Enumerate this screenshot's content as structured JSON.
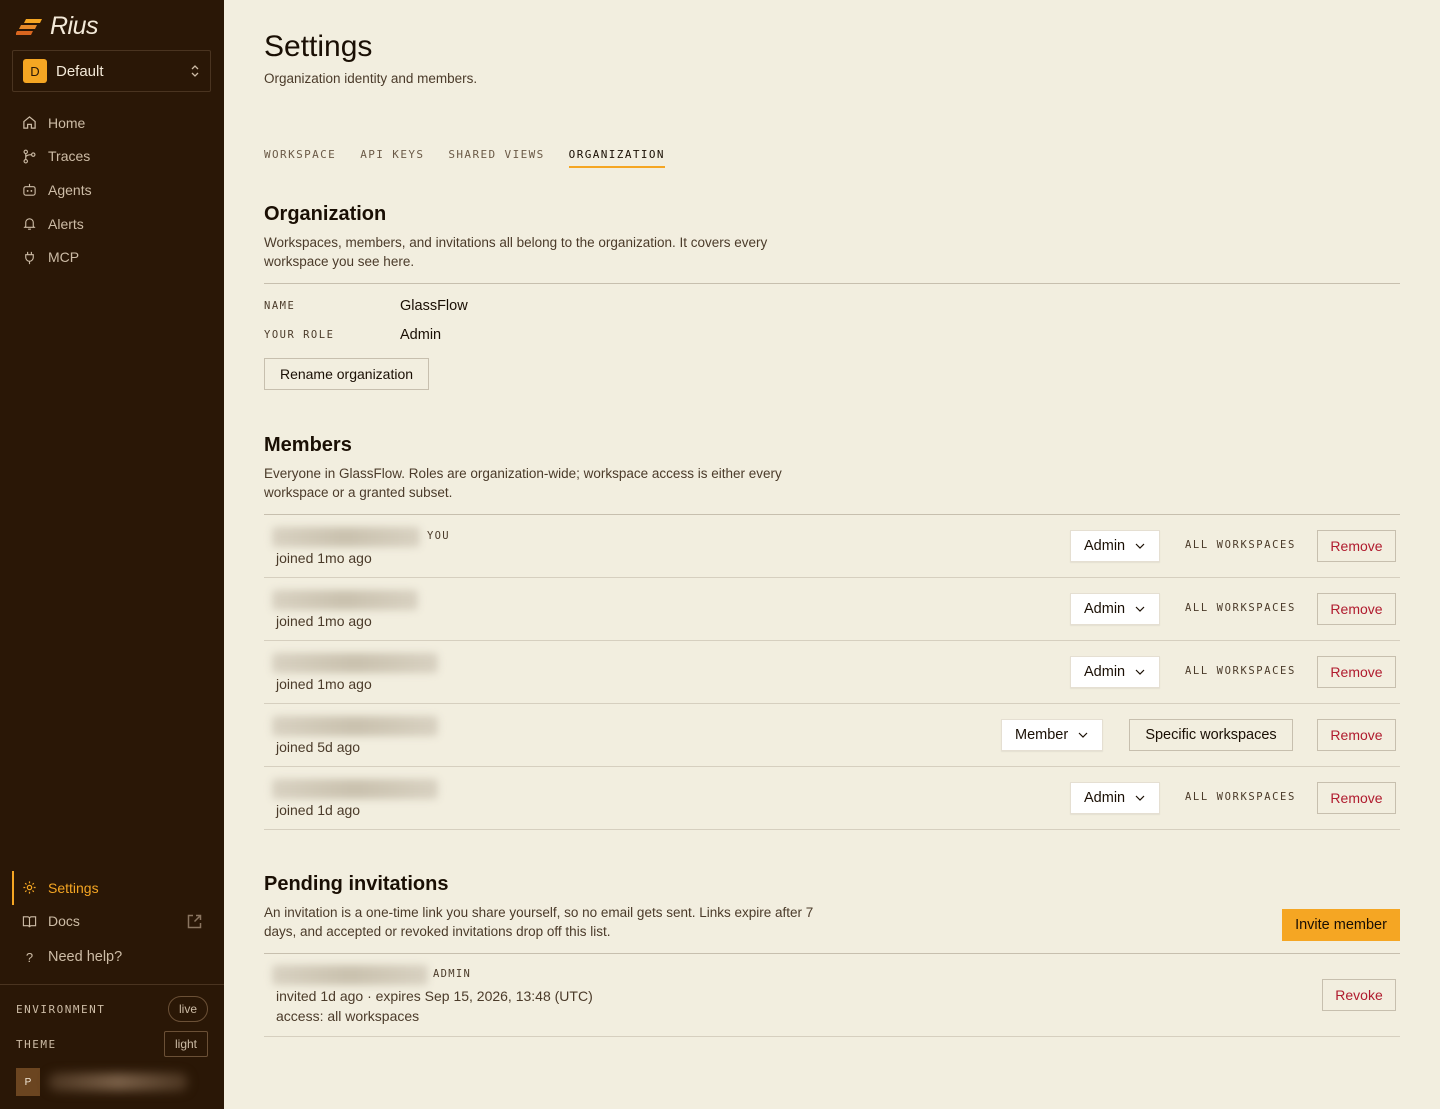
{
  "app": {
    "name": "Rius"
  },
  "workspace_selector": {
    "badge": "D",
    "name": "Default"
  },
  "nav": {
    "items": [
      {
        "label": "Home",
        "icon": "home-icon"
      },
      {
        "label": "Traces",
        "icon": "traces-icon"
      },
      {
        "label": "Agents",
        "icon": "agents-icon"
      },
      {
        "label": "Alerts",
        "icon": "bell-icon"
      },
      {
        "label": "MCP",
        "icon": "plug-icon"
      }
    ],
    "bottom": [
      {
        "label": "Settings",
        "icon": "gear-icon",
        "active": true
      },
      {
        "label": "Docs",
        "icon": "book-icon"
      },
      {
        "label": "Need help?",
        "icon": "question-icon"
      }
    ]
  },
  "footer": {
    "environment_label": "ENVIRONMENT",
    "environment_value": "live",
    "theme_label": "THEME",
    "theme_value": "light",
    "user_initial": "P"
  },
  "page": {
    "title": "Settings",
    "subtitle": "Organization identity and members."
  },
  "tabs": [
    {
      "label": "WORKSPACE",
      "active": false
    },
    {
      "label": "API KEYS",
      "active": false
    },
    {
      "label": "SHARED VIEWS",
      "active": false
    },
    {
      "label": "ORGANIZATION",
      "active": true
    }
  ],
  "organization": {
    "title": "Organization",
    "description": "Workspaces, members, and invitations all belong to the organization. It covers every workspace you see here.",
    "name_label": "NAME",
    "name_value": "GlassFlow",
    "role_label": "YOUR ROLE",
    "role_value": "Admin",
    "rename_button": "Rename organization"
  },
  "members": {
    "title": "Members",
    "description": "Everyone in GlassFlow. Roles are organization-wide; workspace access is either every workspace or a granted subset.",
    "you_tag": "YOU",
    "remove_label": "Remove",
    "rows": [
      {
        "joined": "joined 1mo ago",
        "role": "Admin",
        "access": "ALL WORKSPACES",
        "is_you": true
      },
      {
        "joined": "joined 1mo ago",
        "role": "Admin",
        "access": "ALL WORKSPACES",
        "is_you": false
      },
      {
        "joined": "joined 1mo ago",
        "role": "Admin",
        "access": "ALL WORKSPACES",
        "is_you": false
      },
      {
        "joined": "joined 5d ago",
        "role": "Member",
        "access": "Specific workspaces",
        "is_you": false
      },
      {
        "joined": "joined 1d ago",
        "role": "Admin",
        "access": "ALL WORKSPACES",
        "is_you": false
      }
    ]
  },
  "invitations": {
    "title": "Pending invitations",
    "description": "An invitation is a one-time link you share yourself, so no email gets sent. Links expire after 7 days, and accepted or revoked invitations drop off this list.",
    "invite_button": "Invite member",
    "rows": [
      {
        "role_tag": "ADMIN",
        "meta": "invited 1d ago · expires Sep 15, 2026, 13:48 (UTC)",
        "access": "access: all workspaces",
        "revoke_label": "Revoke"
      }
    ]
  },
  "colors": {
    "accent": "#f5a623",
    "sidebar_bg": "#2a1706",
    "page_bg": "#f2eedf",
    "danger": "#b01b2e"
  }
}
